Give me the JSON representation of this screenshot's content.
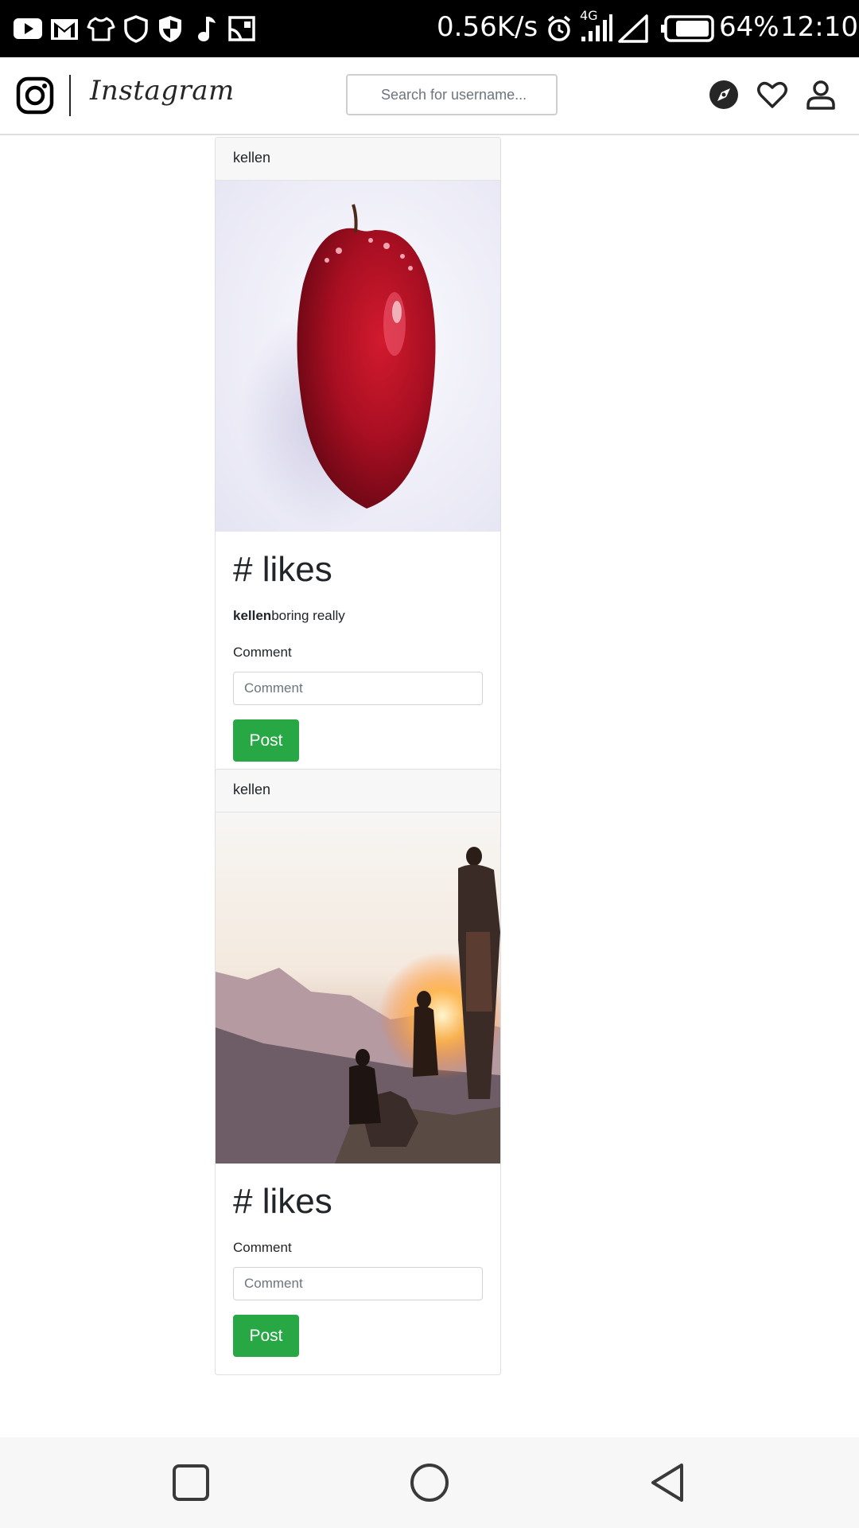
{
  "status_bar": {
    "network_speed": "0.56K/s",
    "network_type": "4G",
    "battery_percent": "64%",
    "time": "12:10",
    "notification_icons": [
      "youtube-icon",
      "gmail-icon",
      "shirt-icon",
      "shield-icon",
      "security-shield-icon",
      "music-note-icon",
      "cast-icon"
    ],
    "status_icons": [
      "alarm-icon",
      "signal-icon",
      "signal-empty-icon",
      "battery-icon"
    ]
  },
  "navbar": {
    "brand": "Instagram",
    "search_placeholder": "Search for username...",
    "icons": [
      "explore-icon",
      "heart-icon",
      "profile-icon"
    ]
  },
  "posts": [
    {
      "username": "kellen",
      "image": "apple-photo",
      "likes_label": "# likes",
      "caption_user": "kellen",
      "caption_text": "boring really",
      "comment_label": "Comment",
      "comment_placeholder": "Comment",
      "post_label": "Post"
    },
    {
      "username": "kellen",
      "image": "mountain-sunset-photo",
      "likes_label": "# likes",
      "comment_label": "Comment",
      "comment_placeholder": "Comment",
      "post_label": "Post"
    }
  ],
  "android_nav": {
    "buttons": [
      "recents-square-icon",
      "home-circle-icon",
      "back-triangle-icon"
    ]
  },
  "colors": {
    "post_button": "#28a745",
    "card_header_bg": "#f7f7f7",
    "status_bar_bg": "#000000"
  }
}
